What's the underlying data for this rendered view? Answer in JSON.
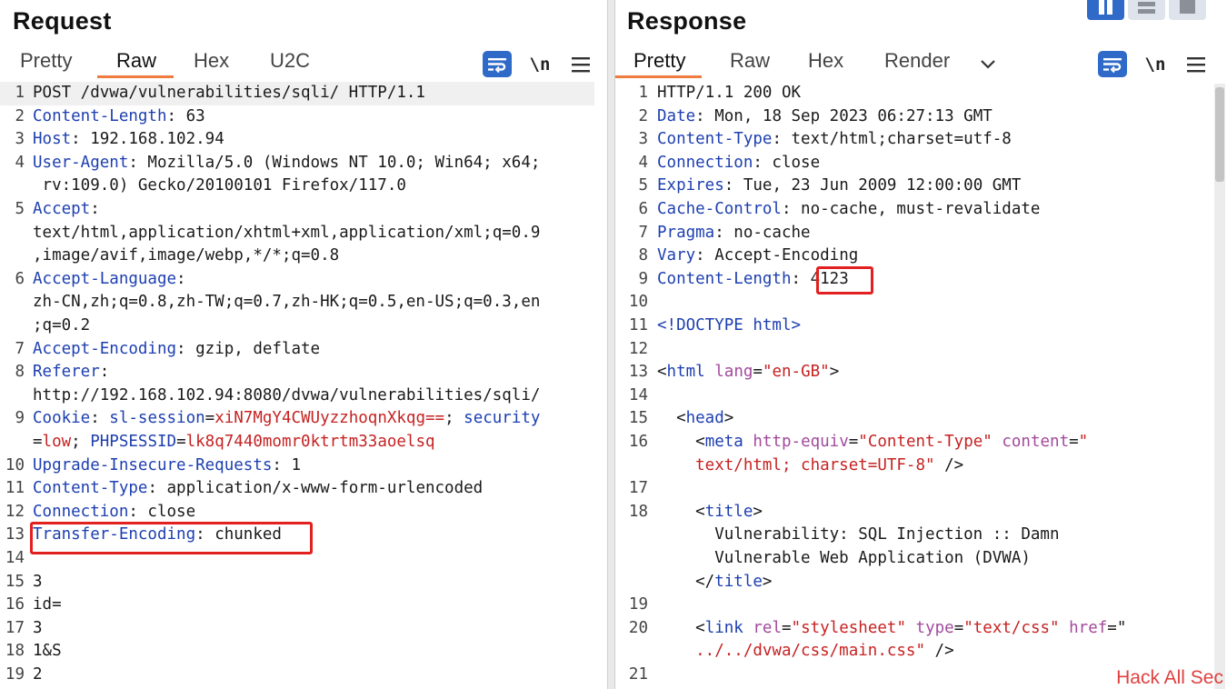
{
  "request": {
    "title": "Request",
    "tabs": [
      "Pretty",
      "Raw",
      "Hex",
      "U2C"
    ],
    "active_tab": "Raw",
    "newline_toggle": "\\n",
    "lines": [
      {
        "n": "1",
        "segs": [
          [
            "v",
            "POST /dvwa/vulnerabilities/sqli/ HTTP/1.1"
          ]
        ]
      },
      {
        "n": "2",
        "segs": [
          [
            "k",
            "Content-Length"
          ],
          [
            "v",
            ": 63"
          ]
        ]
      },
      {
        "n": "3",
        "segs": [
          [
            "k",
            "Host"
          ],
          [
            "v",
            ": 192.168.102.94"
          ]
        ]
      },
      {
        "n": "4",
        "segs": [
          [
            "k",
            "User-Agent"
          ],
          [
            "v",
            ": Mozilla/5.0 (Windows NT 10.0; Win64; x64;"
          ]
        ]
      },
      {
        "n": "",
        "segs": [
          [
            "v",
            " rv:109.0) Gecko/20100101 Firefox/117.0"
          ]
        ]
      },
      {
        "n": "5",
        "segs": [
          [
            "k",
            "Accept"
          ],
          [
            "v",
            ":"
          ]
        ]
      },
      {
        "n": "",
        "segs": [
          [
            "v",
            "text/html,application/xhtml+xml,application/xml;q=0.9"
          ]
        ]
      },
      {
        "n": "",
        "segs": [
          [
            "v",
            ",image/avif,image/webp,*/*;q=0.8"
          ]
        ]
      },
      {
        "n": "6",
        "segs": [
          [
            "k",
            "Accept-Language"
          ],
          [
            "v",
            ":"
          ]
        ]
      },
      {
        "n": "",
        "segs": [
          [
            "v",
            "zh-CN,zh;q=0.8,zh-TW;q=0.7,zh-HK;q=0.5,en-US;q=0.3,en"
          ]
        ]
      },
      {
        "n": "",
        "segs": [
          [
            "v",
            ";q=0.2"
          ]
        ]
      },
      {
        "n": "7",
        "segs": [
          [
            "k",
            "Accept-Encoding"
          ],
          [
            "v",
            ": gzip, deflate"
          ]
        ]
      },
      {
        "n": "8",
        "segs": [
          [
            "k",
            "Referer"
          ],
          [
            "v",
            ":"
          ]
        ]
      },
      {
        "n": "",
        "segs": [
          [
            "v",
            "http://192.168.102.94:8080/dvwa/vulnerabilities/sqli/"
          ]
        ]
      },
      {
        "n": "9",
        "segs": [
          [
            "k",
            "Cookie"
          ],
          [
            "v",
            ": "
          ],
          [
            "k",
            "sl-session"
          ],
          [
            "v",
            "="
          ],
          [
            "r",
            "xiN7MgY4CWUyzzhoqnXkqg=="
          ],
          [
            "v",
            "; "
          ],
          [
            "k",
            "security"
          ]
        ]
      },
      {
        "n": "",
        "segs": [
          [
            "v",
            "="
          ],
          [
            "r",
            "low"
          ],
          [
            "v",
            "; "
          ],
          [
            "k",
            "PHPSESSID"
          ],
          [
            "v",
            "="
          ],
          [
            "r",
            "lk8q7440momr0ktrtm33aoelsq"
          ]
        ]
      },
      {
        "n": "10",
        "segs": [
          [
            "k",
            "Upgrade-Insecure-Requests"
          ],
          [
            "v",
            ": 1"
          ]
        ]
      },
      {
        "n": "11",
        "segs": [
          [
            "k",
            "Content-Type"
          ],
          [
            "v",
            ": application/x-www-form-urlencoded"
          ]
        ]
      },
      {
        "n": "12",
        "segs": [
          [
            "k",
            "Connection"
          ],
          [
            "v",
            ": close"
          ]
        ]
      },
      {
        "n": "13",
        "segs": [
          [
            "k",
            "Transfer-Encoding"
          ],
          [
            "v",
            ": chunked"
          ]
        ]
      },
      {
        "n": "14",
        "segs": []
      },
      {
        "n": "15",
        "segs": [
          [
            "v",
            "3"
          ]
        ]
      },
      {
        "n": "16",
        "segs": [
          [
            "v",
            "id="
          ]
        ]
      },
      {
        "n": "17",
        "segs": [
          [
            "v",
            "3"
          ]
        ]
      },
      {
        "n": "18",
        "segs": [
          [
            "v",
            "1&S"
          ]
        ]
      },
      {
        "n": "19",
        "segs": [
          [
            "v",
            "2"
          ]
        ]
      }
    ]
  },
  "response": {
    "title": "Response",
    "tabs": [
      "Pretty",
      "Raw",
      "Hex",
      "Render"
    ],
    "active_tab": "Pretty",
    "newline_toggle": "\\n",
    "lines": [
      {
        "n": "1",
        "segs": [
          [
            "v",
            "HTTP/1.1 200 OK"
          ]
        ]
      },
      {
        "n": "2",
        "segs": [
          [
            "k",
            "Date"
          ],
          [
            "v",
            ": Mon, 18 Sep 2023 06:27:13 GMT"
          ]
        ]
      },
      {
        "n": "3",
        "segs": [
          [
            "k",
            "Content-Type"
          ],
          [
            "v",
            ": text/html;charset=utf-8"
          ]
        ]
      },
      {
        "n": "4",
        "segs": [
          [
            "k",
            "Connection"
          ],
          [
            "v",
            ": close"
          ]
        ]
      },
      {
        "n": "5",
        "segs": [
          [
            "k",
            "Expires"
          ],
          [
            "v",
            ": Tue, 23 Jun 2009 12:00:00 GMT"
          ]
        ]
      },
      {
        "n": "6",
        "segs": [
          [
            "k",
            "Cache-Control"
          ],
          [
            "v",
            ": no-cache, must-revalidate"
          ]
        ]
      },
      {
        "n": "7",
        "segs": [
          [
            "k",
            "Pragma"
          ],
          [
            "v",
            ": no-cache"
          ]
        ]
      },
      {
        "n": "8",
        "segs": [
          [
            "k",
            "Vary"
          ],
          [
            "v",
            ": Accept-Encoding"
          ]
        ]
      },
      {
        "n": "9",
        "segs": [
          [
            "k",
            "Content-Length"
          ],
          [
            "v",
            ": 4123"
          ]
        ]
      },
      {
        "n": "10",
        "segs": []
      },
      {
        "n": "11",
        "segs": [
          [
            "t",
            "<!DOCTYPE html>"
          ]
        ]
      },
      {
        "n": "12",
        "segs": []
      },
      {
        "n": "13",
        "segs": [
          [
            "v",
            "<"
          ],
          [
            "t",
            "html"
          ],
          [
            "v",
            " "
          ],
          [
            "a",
            "lang"
          ],
          [
            "v",
            "="
          ],
          [
            "s",
            "\"en-GB\""
          ],
          [
            "v",
            ">"
          ]
        ]
      },
      {
        "n": "14",
        "segs": []
      },
      {
        "n": "15",
        "segs": [
          [
            "v",
            "  <"
          ],
          [
            "t",
            "head"
          ],
          [
            "v",
            ">"
          ]
        ]
      },
      {
        "n": "16",
        "segs": [
          [
            "v",
            "    <"
          ],
          [
            "t",
            "meta"
          ],
          [
            "v",
            " "
          ],
          [
            "a",
            "http-equiv"
          ],
          [
            "v",
            "="
          ],
          [
            "s",
            "\"Content-Type\""
          ],
          [
            "v",
            " "
          ],
          [
            "a",
            "content"
          ],
          [
            "v",
            "="
          ],
          [
            "s",
            "\""
          ]
        ]
      },
      {
        "n": "",
        "segs": [
          [
            "s",
            "    text/html; charset=UTF-8\""
          ],
          [
            "v",
            " />"
          ]
        ]
      },
      {
        "n": "17",
        "segs": []
      },
      {
        "n": "18",
        "segs": [
          [
            "v",
            "    <"
          ],
          [
            "t",
            "title"
          ],
          [
            "v",
            ">"
          ]
        ]
      },
      {
        "n": "",
        "segs": [
          [
            "v",
            "      Vulnerability: SQL Injection :: Damn"
          ]
        ]
      },
      {
        "n": "",
        "segs": [
          [
            "v",
            "      Vulnerable Web Application (DVWA)"
          ]
        ]
      },
      {
        "n": "",
        "segs": [
          [
            "v",
            "    </"
          ],
          [
            "t",
            "title"
          ],
          [
            "v",
            ">"
          ]
        ]
      },
      {
        "n": "19",
        "segs": []
      },
      {
        "n": "20",
        "segs": [
          [
            "v",
            "    <"
          ],
          [
            "t",
            "link"
          ],
          [
            "v",
            " "
          ],
          [
            "a",
            "rel"
          ],
          [
            "v",
            "="
          ],
          [
            "s",
            "\"stylesheet\""
          ],
          [
            "v",
            " "
          ],
          [
            "a",
            "type"
          ],
          [
            "v",
            "="
          ],
          [
            "s",
            "\"text/css\""
          ],
          [
            "v",
            " "
          ],
          [
            "a",
            "href"
          ],
          [
            "v",
            "=\""
          ]
        ]
      },
      {
        "n": "",
        "segs": [
          [
            "s",
            "    ../../dvwa/css/main.css\""
          ],
          [
            "v",
            " />"
          ]
        ]
      },
      {
        "n": "21",
        "segs": []
      }
    ]
  },
  "watermark": "Hack All Sec",
  "colors": {
    "accent": "#f07b3f",
    "button": "#2f6ac9",
    "highlight_box": "#e32020",
    "header_key": "#1d3fb0",
    "value_red": "#c62222"
  }
}
